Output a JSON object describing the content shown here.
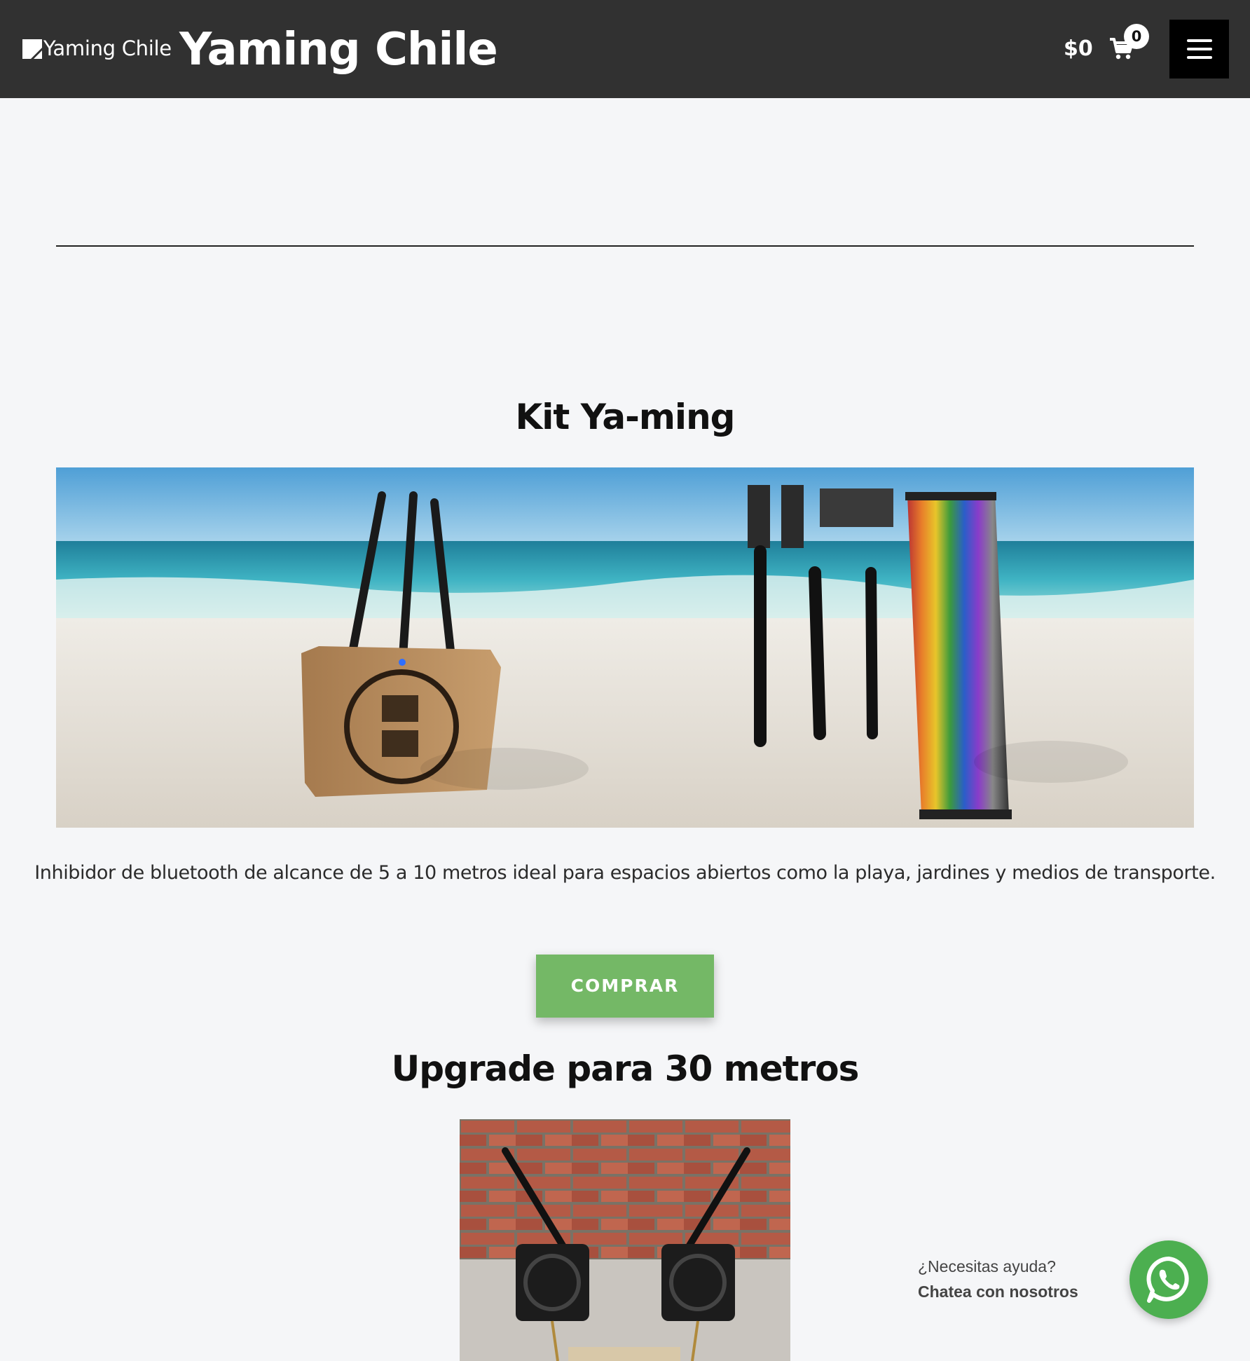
{
  "header": {
    "logo_alt": "Yaming Chile",
    "site_title": "Yaming Chile",
    "cart_total": "$0",
    "cart_count": "0",
    "menu_icon": "hamburger-icon",
    "cart_icon": "shopping-cart-icon"
  },
  "kit": {
    "title": "Kit Ya-ming",
    "description": "Inhibidor de bluetooth de alcance de 5 a 10 metros ideal para espacios abiertos como la playa, jardines y medios de transporte.",
    "button_label": "COMPRAR"
  },
  "upgrade": {
    "title": "Upgrade para 30 metros"
  },
  "whatsapp": {
    "help_text": "¿Necesitas ayuda?",
    "chat_text": "Chatea con nosotros",
    "icon": "whatsapp-icon"
  },
  "colors": {
    "header_bg": "#313131",
    "button_green": "#74b866",
    "whatsapp_green": "#4caf50",
    "page_bg": "#f5f6f8"
  }
}
